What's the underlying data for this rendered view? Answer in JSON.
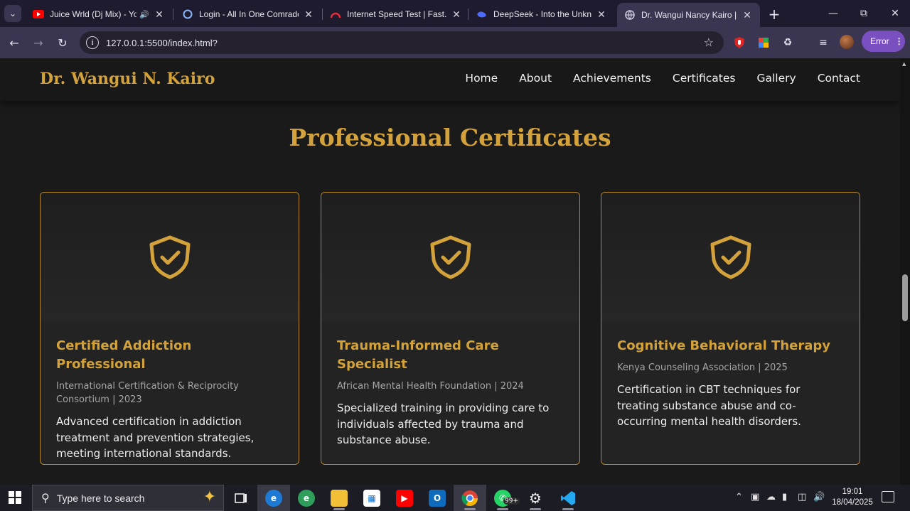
{
  "browser": {
    "tabs": [
      {
        "title": "Juice Wrld (Dj Mix) - You",
        "favicon": "youtube-icon",
        "audio": true
      },
      {
        "title": "Login - All In One Comrade",
        "favicon": "loading-ring-icon"
      },
      {
        "title": "Internet Speed Test | Fast.co",
        "favicon": "speedometer-icon"
      },
      {
        "title": "DeepSeek - Into the Unkno",
        "favicon": "whale-icon"
      },
      {
        "title": "Dr. Wangui Nancy Kairo | Co",
        "favicon": "globe-icon",
        "active": true
      }
    ],
    "url": "127.0.0.1:5500/index.html?",
    "profile_status": "Error"
  },
  "site": {
    "logo": "Dr. Wangui N. Kairo",
    "nav": [
      "Home",
      "About",
      "Achievements",
      "Certificates",
      "Gallery",
      "Contact"
    ],
    "section_title": "Professional Certificates",
    "certificates": [
      {
        "title": "Certified Addiction Professional",
        "issuer": "International Certification & Reciprocity Consortium | 2023",
        "description": "Advanced certification in addiction treatment and prevention strategies, meeting international standards."
      },
      {
        "title": "Trauma-Informed Care Specialist",
        "issuer": "African Mental Health Foundation | 2024",
        "description": "Specialized training in providing care to individuals affected by trauma and substance abuse."
      },
      {
        "title": "Cognitive Behavioral Therapy",
        "issuer": "Kenya Counseling Association | 2025",
        "description": "Certification in CBT techniques for treating substance abuse and co-occurring mental health disorders."
      }
    ],
    "accent_color": "#d4a23a"
  },
  "taskbar": {
    "search_placeholder": "Type here to search",
    "whatsapp_badge": "99+",
    "time": "19:01",
    "date": "18/04/2025"
  }
}
